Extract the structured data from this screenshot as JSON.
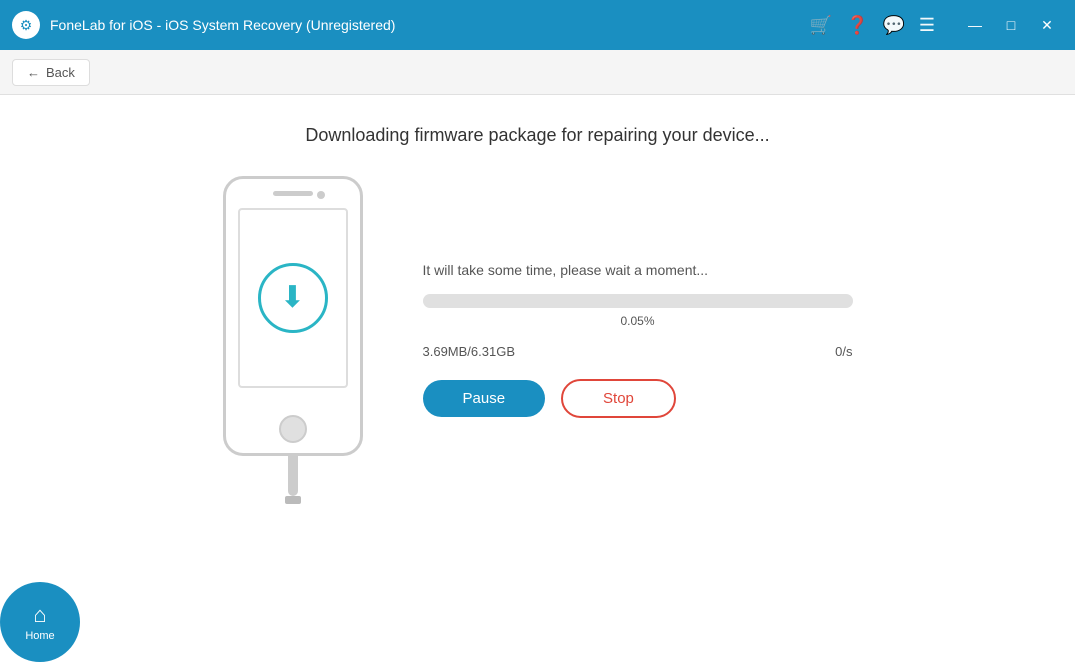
{
  "titlebar": {
    "title": "FoneLab for iOS - iOS System Recovery (Unregistered)",
    "icon_symbol": "⚙"
  },
  "nav": {
    "back_label": "Back"
  },
  "main": {
    "page_title": "Downloading firmware package for repairing your device...",
    "wait_text": "It will take some time, please wait a moment...",
    "progress_percent": 0.05,
    "progress_label": "0.05%",
    "size_downloaded": "3.69MB/6.31GB",
    "speed": "0/s",
    "pause_label": "Pause",
    "stop_label": "Stop"
  },
  "bottom_nav": {
    "home_label": "Home"
  }
}
